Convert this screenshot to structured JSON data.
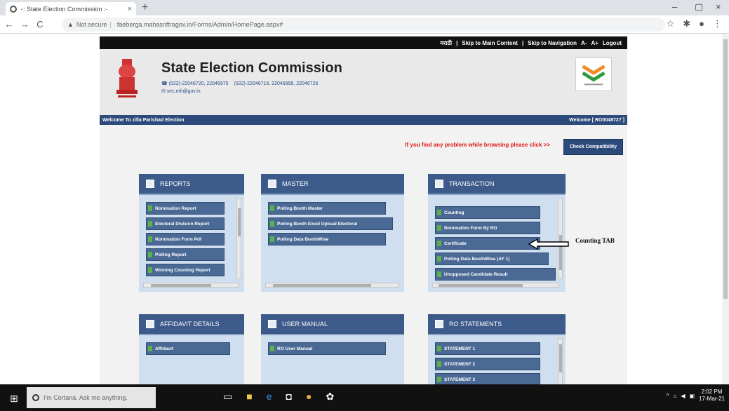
{
  "browser": {
    "tab_title": "-: State Election Commission :-",
    "tab_close": "×",
    "new_tab": "+",
    "minimize": "–",
    "maximize": "▢",
    "close": "×",
    "back": "←",
    "forward": "→",
    "reload": "C",
    "security_label": "Not secure",
    "url": "faeberga.mahasnftragov.in/Forms/Admin/HomePage.aspx#",
    "star": "☆",
    "profile": "●",
    "menu": "⋮"
  },
  "site": {
    "top_links": [
      "मराठी",
      "|",
      "Skip to Main Content",
      "|",
      "Skip to Navigation",
      "A-",
      "A+",
      "Logout"
    ],
    "title": "State Election Commission",
    "contact_phone": "☎ (022)-22046720, 22046975",
    "contact_fax": "(022)-22046716, 22046956, 22046726",
    "contact_email": "✉ sec.mh@gov.in",
    "welcome_left": "Welcome To zilla Parishad Election",
    "welcome_right": "Welcome [ RO0048727 ]",
    "notice": "If you find any problem while browsing please click >>",
    "compat_button": "Check Compatibility"
  },
  "panels": {
    "reports": {
      "title": "REPORTS",
      "items": [
        "Nomination Report",
        "Electoral Division Report",
        "Nomination Form Pdf",
        "Polling Report",
        "Winning Counting Report"
      ]
    },
    "master": {
      "title": "MASTER",
      "items": [
        "Polling Booth Master",
        "Polling Booth Excel Upload Electoral",
        "Polling Data BoothWise"
      ]
    },
    "transaction": {
      "title": "TRANSACTION",
      "items": [
        "Counting",
        "Nomination Form By RO",
        "Certificate",
        "Polling Data BoothWise (AF 1)",
        "Unopposed Candidate Result"
      ]
    },
    "affidavit": {
      "title": "AFFIDAVIT DETAILS",
      "items": [
        "Affidavit"
      ]
    },
    "user_manual": {
      "title": "USER MANUAL",
      "items": [
        "RO User Manual"
      ]
    },
    "ro_statements": {
      "title": "RO STATEMENTS",
      "items": [
        "STATEMENT 1",
        "STATEMENT 2",
        "STATEMENT 3"
      ]
    }
  },
  "annotation": {
    "label": "Counting TAB"
  },
  "taskbar": {
    "search_placeholder": "I'm Cortana. Ask me anything.",
    "time": "2:02 PM",
    "date": "17-Mar-21"
  }
}
